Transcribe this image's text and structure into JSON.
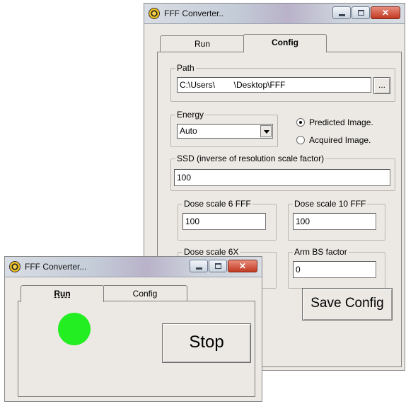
{
  "back_window": {
    "title": "FFF Converter..",
    "tabs": [
      {
        "label": "Run"
      },
      {
        "label": "Config"
      }
    ],
    "active_tab": "Config",
    "path": {
      "label": "Path",
      "value": "C:\\Users\\        \\Desktop\\FFF",
      "browse_label": "..."
    },
    "energy": {
      "label": "Energy",
      "selected": "Auto"
    },
    "image_options": {
      "predicted_label": "Predicted Image.",
      "acquired_label": "Acquired Image.",
      "selected": "predicted"
    },
    "ssd": {
      "label": "SSD (inverse of resolution scale factor)",
      "value": "100"
    },
    "dose_scale_6fff": {
      "label": "Dose scale 6 FFF",
      "value": "100"
    },
    "dose_scale_10fff": {
      "label": "Dose scale 10 FFF",
      "value": "100"
    },
    "dose_scale_6x": {
      "label": "Dose scale 6X"
    },
    "arm_bs_factor": {
      "label": "Arm BS factor",
      "value": "0"
    },
    "save_config_label": "Save Config"
  },
  "front_window": {
    "title": "FFF Converter...",
    "tabs": [
      {
        "label": "Run"
      },
      {
        "label": "Config"
      }
    ],
    "active_tab": "Run",
    "status_color": "#22ee22",
    "stop_label": "Stop"
  },
  "colors": {
    "window_bg": "#ece9e4",
    "status_green": "#22ee22",
    "close_red": "#c23a22"
  }
}
